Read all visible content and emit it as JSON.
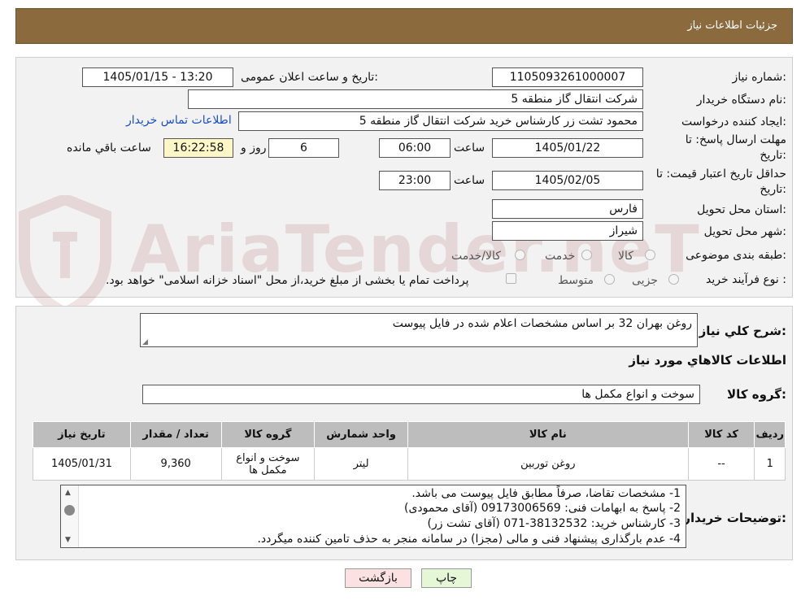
{
  "header": {
    "title": "جزئیات اطلاعات نیاز"
  },
  "form": {
    "need_number_label": "شماره نیاز:",
    "need_number": "1105093261000007",
    "announce_label": "تاریخ و ساعت اعلان عمومی:",
    "announce_value": "1405/01/15 - 13:20",
    "buyer_org_label": "نام دستگاه خریدار:",
    "buyer_org": "شرکت انتقال گاز منطقه 5",
    "creator_label": "ایجاد کننده درخواست:",
    "creator": "محمود تشت زر کارشناس خرید شرکت انتقال گاز منطقه 5",
    "contact_link": "اطلاعات تماس خریدار",
    "deadline_label_1": "مهلت ارسال پاسخ: تا",
    "deadline_label_2": "تاریخ:",
    "deadline_date": "1405/01/22",
    "time_label": "ساعت",
    "deadline_time": "06:00",
    "days_value": "6",
    "days_label": "روز و",
    "remaining_time": "16:22:58",
    "remaining_label": "ساعت باقي مانده",
    "validity_label_1": "حداقل تاریخ اعتبار قیمت: تا",
    "validity_label_2": "تاریخ:",
    "validity_date": "1405/02/05",
    "validity_time_label": "ساعت",
    "validity_time": "23:00",
    "province_label": "استان محل تحویل:",
    "province": "فارس",
    "city_label": "شهر محل تحویل:",
    "city": "شیراز",
    "category_label": "طبقه بندی موضوعی:",
    "category_options": [
      "کالا",
      "خدمت",
      "کالا/خدمت"
    ],
    "process_label": "نوع فرآیند خرید :",
    "process_options": [
      "جزیی",
      "متوسط"
    ],
    "payment_text": "پرداخت تمام یا بخشی از مبلغ خرید،از محل \"اسناد خزانه اسلامی\" خواهد بود."
  },
  "description": {
    "label": "شرح کلي نياز:",
    "value": "روغن بهران 32 بر اساس مشخصات اعلام شده در فایل پیوست",
    "goods_info_title": "اطلاعات کالاهاي مورد نياز",
    "group_label": "گروه کالا:",
    "group_value": "سوخت و انواع مکمل ها"
  },
  "table": {
    "headers": [
      "ردیف",
      "کد کالا",
      "نام کالا",
      "واحد شمارش",
      "گروه کالا",
      "تعداد / مقدار",
      "تاریخ نیاز"
    ],
    "rows": [
      [
        "1",
        "--",
        "روغن توربین",
        "لیتر",
        "سوخت و انواع مکمل ها",
        "9,360",
        "1405/01/31"
      ]
    ]
  },
  "notes": {
    "label": "توضیحات خریدار:",
    "lines": [
      "1-  مشخصات تقاضا، صرفاً مطابق فایل پیوست می باشد.",
      "2- پاسخ به ابهامات فنی: 09173006569 (آقای محمودی)",
      "3- کارشناس خرید: 38132532-071 (آقای تشت زر)",
      "4- عدم بارگذاری پیشنهاد فنی و مالی (مجزا) در سامانه منجر به حذف تامین کننده میگردد."
    ]
  },
  "buttons": {
    "print": "چاپ",
    "back": "بازگشت"
  },
  "watermark": "AriaTender.neT"
}
